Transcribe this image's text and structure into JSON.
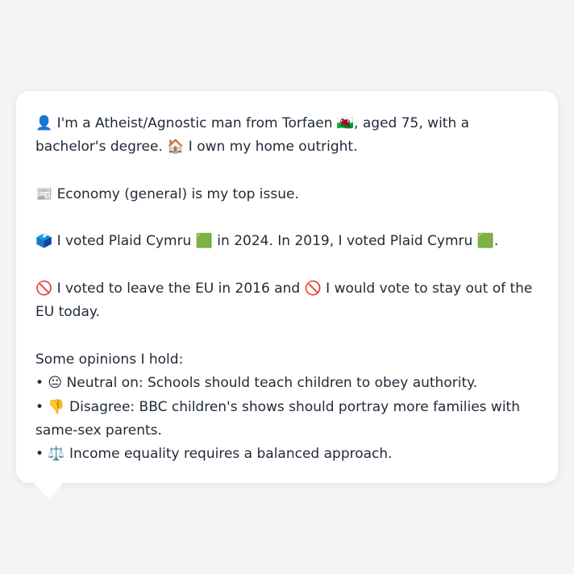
{
  "profile": {
    "intro_line": "👤 I'm a Atheist/Agnostic man from Torfaen 🏴󠁧󠁢󠁷󠁬󠁳󠁿, aged 75, with a bachelor's degree. 🏠 I own my home outright.",
    "issue_line": "📰 Economy (general) is my top issue.",
    "vote_line": "🗳️ I voted Plaid Cymru 🟩 in 2024. In 2019, I voted Plaid Cymru 🟩.",
    "eu_line": "🚫 I voted to leave the EU in 2016 and 🚫 I would vote to stay out of the EU today.",
    "opinions_heading": "Some opinions I hold:",
    "opinions": [
      "• 😐 Neutral on: Schools should teach children to obey authority.",
      "• 👎 Disagree: BBC children's shows should portray more families with same-sex parents.",
      "• ⚖️ Income equality requires a balanced approach."
    ]
  }
}
